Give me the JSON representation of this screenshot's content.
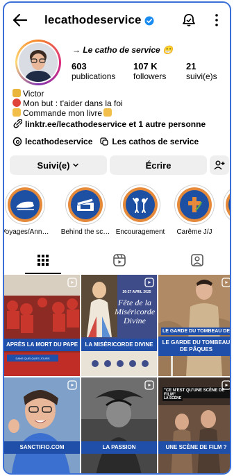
{
  "header": {
    "username": "lecathodeservice"
  },
  "profile": {
    "display_name": "→ Le catho de service 😁",
    "stats": [
      {
        "value": "603",
        "label": "publications"
      },
      {
        "value": "107 K",
        "label": "followers"
      },
      {
        "value": "21",
        "label": "suivi(e)s"
      }
    ],
    "bio": [
      {
        "emoji_color": "#e9b53a",
        "text": "Victor"
      },
      {
        "emoji_color": "#e0433a",
        "text": "Mon but : t'aider dans la foi"
      },
      {
        "emoji_color": "#f2c04a",
        "text": "Commande mon livre"
      }
    ],
    "link": "linktr.ee/lecathodeservice et 1 autre personne",
    "threads_handle": "lecathodeservice",
    "community": "Les cathos de service"
  },
  "actions": {
    "follow_label": "Suivi(e)",
    "message_label": "Écrire"
  },
  "highlights": [
    {
      "label": "Voyages/Ann…"
    },
    {
      "label": "Behind the sc…"
    },
    {
      "label": "Encouragement"
    },
    {
      "label": "Carême J/J"
    }
  ],
  "posts": [
    {
      "caption": "APRÈS LA MORT DU PAPE",
      "bg": "#b8322a"
    },
    {
      "caption": "LA MISÉRICORDE DIVINE",
      "bg": "#3e4c8a"
    },
    {
      "caption": "LE GARDE DU TOMBEAU DE PÂQUES",
      "bg": "#8a6d4e"
    },
    {
      "caption": "SANCTIFIO.COM",
      "bg": "#6b88b8"
    },
    {
      "caption": "LA PASSION",
      "bg": "#3c3c3c"
    },
    {
      "caption": "UNE SCÈNE DE FILM ?",
      "bg": "#5a4636"
    }
  ],
  "post_overlays": {
    "p2_title": "Fête de la Miséricorde Divine",
    "p2_date": "26-27 AVRIL 2025",
    "p3_top": "LE GARDE DU TOMBEAU DE",
    "p6_top": "\"CE N'EST QU'UNE SCÈNE DE FILM\"",
    "p6_sub": "LA SCÈNE"
  }
}
